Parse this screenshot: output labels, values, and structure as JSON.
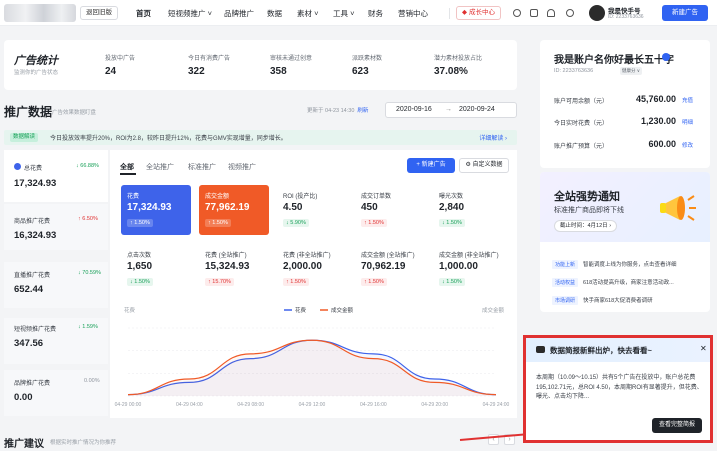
{
  "topbar": {
    "back_label": "退回旧版",
    "nav": [
      "首页",
      "短视频推广 ˅",
      "品牌推广",
      "数据",
      "素材 ˅",
      "工具 ˅",
      "财务",
      "营销中心"
    ],
    "growth_label": "成长中心",
    "account_name": "我是快手号",
    "account_id": "ID: 2233763636",
    "new_ad_label": "新建广告"
  },
  "summary": {
    "title": "广告统计",
    "subtitle": "监测你的广告状态",
    "stats": [
      {
        "label": "投放中广告",
        "value": "24"
      },
      {
        "label": "今日有消费广告",
        "value": "322"
      },
      {
        "label": "审核未通过创意",
        "value": "358"
      },
      {
        "label": "派跃素材数",
        "value": "623"
      },
      {
        "label": "潜力素材投放占比",
        "value": "37.08%"
      }
    ]
  },
  "promo_data": {
    "title": "推广数据",
    "subtitle": "广告效果数据盯盘",
    "updated": "更新于 04-23 14:30",
    "refresh": "刷新",
    "date_start": "2020-09-16",
    "date_arrow": "→",
    "date_end": "2020-09-24",
    "banner_tag": "数据解读",
    "banner_text": "今日投放效率提升20%，ROI为2.8，较昨日提升12%，花费与GMV实现增量，同步增长。",
    "banner_link": "详细解读 ›"
  },
  "side_metrics": [
    {
      "label": "总花费",
      "pct": "↓ 66.88%",
      "value": "17,324.93"
    },
    {
      "label": "商品推广花费",
      "pct": "↑ 6.50%",
      "value": "16,324.93"
    },
    {
      "label": "直播推广花费",
      "pct": "↓ 70.59%",
      "value": "652.44"
    },
    {
      "label": "短视频推广花费",
      "pct": "↓ 1.59%",
      "value": "347.56"
    },
    {
      "label": "品牌推广花费",
      "pct": "0.00%",
      "value": "0.00"
    }
  ],
  "tabs": [
    "全部",
    "全站推广",
    "标准推广",
    "视频推广"
  ],
  "buttons": {
    "new_ad": "+ 新建广告",
    "custom": "⚙ 自定义数据"
  },
  "metric_cards": [
    {
      "label": "花费",
      "value": "17,324.93",
      "pct": "↑ 1.50%"
    },
    {
      "label": "成交金额",
      "value": "77,962.19",
      "pct": "↑ 1.50%"
    },
    {
      "label": "ROI (投产比)",
      "value": "4.50",
      "pct": "↓ 5.90%"
    },
    {
      "label": "成交订单数",
      "value": "450",
      "pct": "↑ 1.50%"
    },
    {
      "label": "曝光次数",
      "value": "2,840",
      "pct": "↓ 1.50%"
    },
    {
      "label": "点击次数",
      "value": "1,650",
      "pct": "↓ 1.50%"
    },
    {
      "label": "花费 (全站推广)",
      "value": "15,324.93",
      "pct": "↑ 15.70%"
    },
    {
      "label": "花费 (非全站推广)",
      "value": "2,000.00",
      "pct": "↑ 1.50%"
    },
    {
      "label": "成交金额 (全站推广)",
      "value": "70,962.19",
      "pct": "↑ 1.50%"
    },
    {
      "label": "成交金额 (非全站推广)",
      "value": "1,000.00",
      "pct": "↓ 1.50%"
    }
  ],
  "chart_data": {
    "type": "line",
    "ylabel_left": "花费",
    "ylabel_right": "成交金额",
    "x": [
      "04-29 00:00",
      "04-29 04:00",
      "04-29 08:00",
      "04-29 12:00",
      "04-29 16:00",
      "04-29 20:00",
      "04-29 24:00"
    ],
    "ylim": [
      0,
      1
    ],
    "series": [
      {
        "name": "花费",
        "color": "#3e63ea",
        "values": [
          0.02,
          0.2,
          0.55,
          0.82,
          0.62,
          0.25,
          0.02
        ]
      },
      {
        "name": "成交金额",
        "color": "#f05a27",
        "values": [
          0.02,
          0.25,
          0.62,
          0.82,
          0.55,
          0.2,
          0.02
        ]
      }
    ]
  },
  "account_card": {
    "title": "我是账户名你好最长五十字",
    "id": "ID: 2233763636",
    "badge": "健康分 ∨",
    "rows": [
      {
        "label": "账户可用余额（元）",
        "value": "45,760.00",
        "link": "充值"
      },
      {
        "label": "今日实时花费（元）",
        "value": "1,230.00",
        "link": "明细"
      },
      {
        "label": "账户推广预算（元）",
        "value": "600.00",
        "link": "修改"
      }
    ]
  },
  "promo_card": {
    "title": "全站强势通知",
    "subtitle": "标准推广商品即将下线",
    "date": "截止时间：4月12日 ›",
    "news": [
      {
        "tag": "功能上新",
        "text": "智能调度上线为你服务，点击查看详细"
      },
      {
        "tag": "活动权益",
        "text": "618活动提高升级，商家注意活动政..."
      },
      {
        "tag": "市场调研",
        "text": "快手商家618大促消费者调研"
      }
    ]
  },
  "popup": {
    "title": "数据简报新鲜出炉，快去看看~",
    "body": "本周期（10.09～10.15）共有5个广告在投放中，账户总花费195,102.71元，总ROI 4.50，本周期ROI有显著提升，但花费、曝光、点击均下降...",
    "button": "查看完整简报",
    "close": "✕"
  },
  "suggestions": {
    "title": "推广建议",
    "subtitle": "根据实时推广情况为你推荐"
  }
}
